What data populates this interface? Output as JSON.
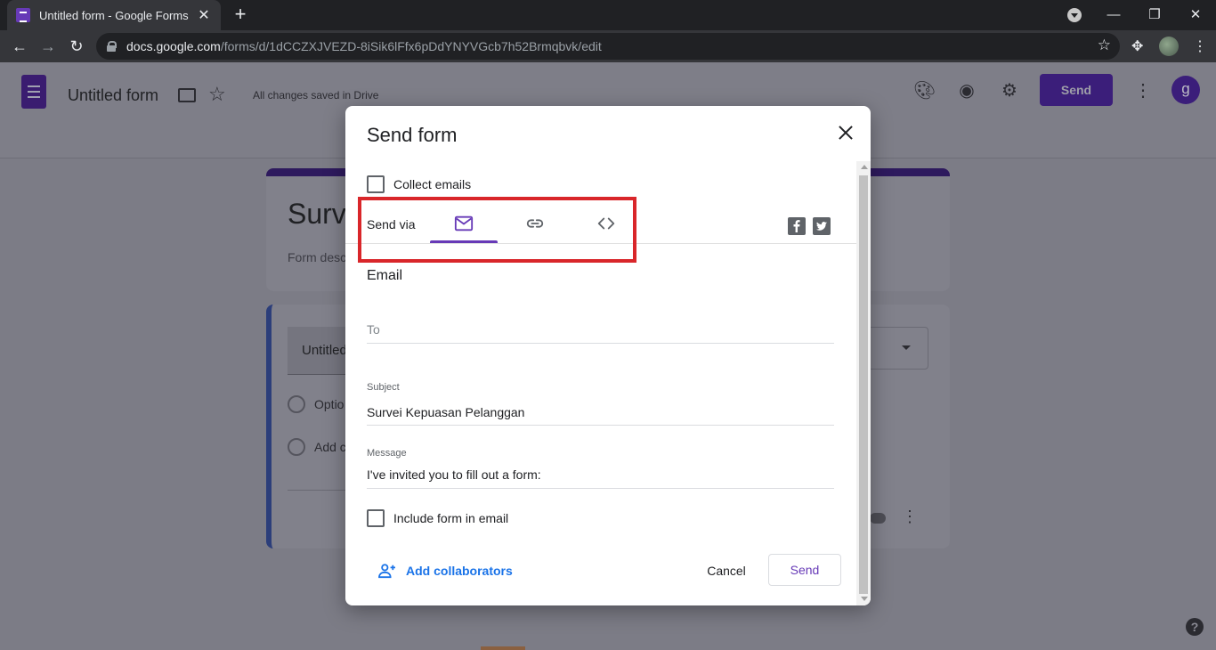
{
  "browser": {
    "tab_title": "Untitled form - Google Forms",
    "url_host": "docs.google.com",
    "url_path": "/forms/d/1dCCZXJVEZD-8iSik6lFfx6pDdYNYVGcb7h52Brmqbvk/edit"
  },
  "app_header": {
    "form_title": "Untitled form",
    "save_status": "All changes saved in Drive",
    "send_label": "Send",
    "avatar_letter": "g"
  },
  "background_form": {
    "title_partial": "Surv",
    "description_partial": "Form desc",
    "question_partial": "Untitled",
    "option1_partial": "Optio",
    "option2_partial": "Add c"
  },
  "dialog": {
    "title": "Send form",
    "collect_emails_label": "Collect emails",
    "send_via_label": "Send via",
    "tabs": [
      {
        "name": "email",
        "icon": "email-icon",
        "active": true
      },
      {
        "name": "link",
        "icon": "link-icon",
        "active": false
      },
      {
        "name": "embed",
        "icon": "embed-code-icon",
        "active": false
      }
    ],
    "section_title": "Email",
    "to_placeholder": "To",
    "subject_label": "Subject",
    "subject_value": "Survei Kepuasan Pelanggan",
    "message_label": "Message",
    "message_value": "I've invited you to fill out a form:",
    "include_form_label": "Include form in email",
    "add_collaborators_label": "Add collaborators",
    "cancel_label": "Cancel",
    "send_label": "Send"
  },
  "colors": {
    "accent": "#673ab7",
    "link_blue": "#1a73e8",
    "highlight_red": "#d9262a"
  }
}
